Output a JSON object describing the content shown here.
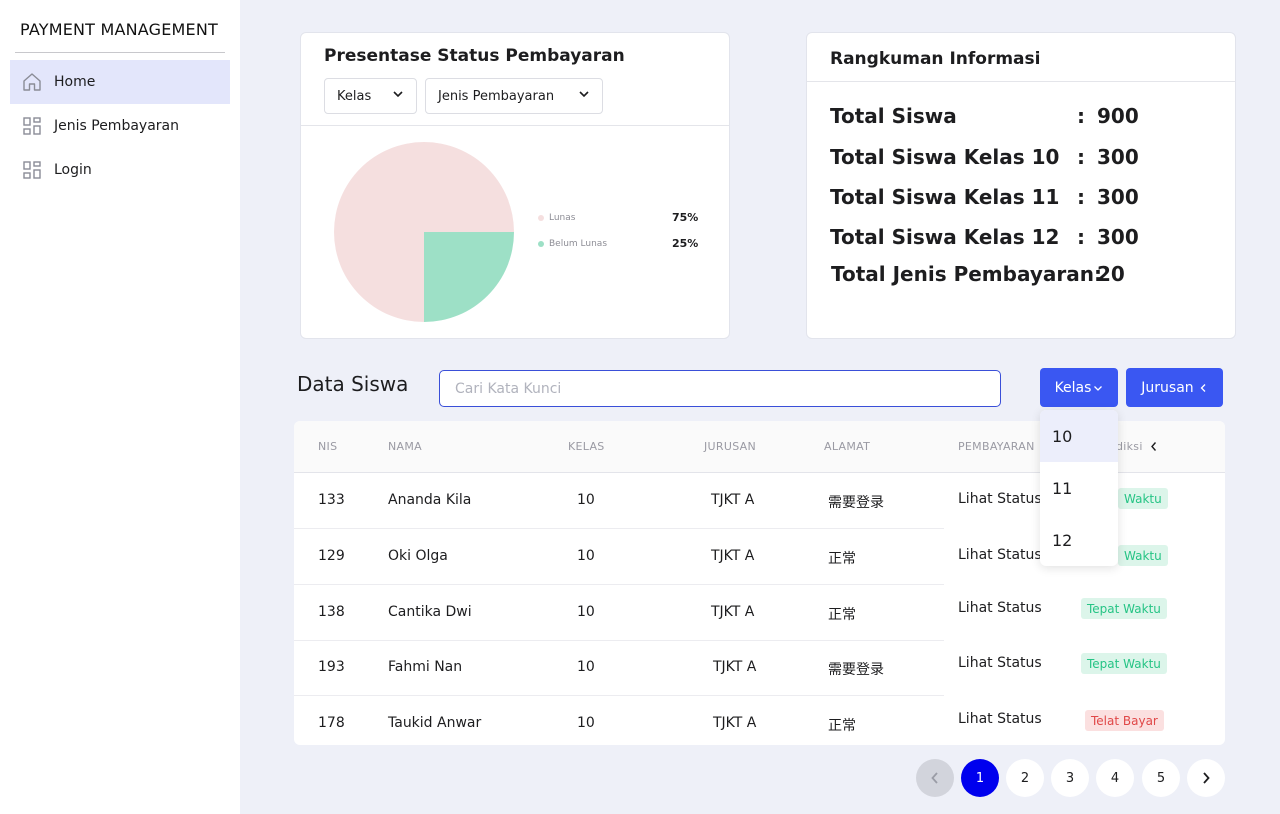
{
  "app": {
    "brand": "PAYMENT MANAGEMENT"
  },
  "sidebar": {
    "items": [
      {
        "label": "Home",
        "icon": "home-icon",
        "active": true
      },
      {
        "label": "Jenis Pembayaran",
        "icon": "grid-icon",
        "active": false
      },
      {
        "label": "Login",
        "icon": "grid-icon",
        "active": false
      }
    ]
  },
  "status_card": {
    "title": "Presentase Status Pembayaran",
    "filter_kelas": "Kelas",
    "filter_jenis": "Jenis Pembayaran",
    "legend": [
      {
        "label": "Lunas",
        "value": "75%",
        "color": "#f5dfdf"
      },
      {
        "label": "Belum Lunas",
        "value": "25%",
        "color": "#9de0c6"
      }
    ]
  },
  "chart_data": {
    "type": "pie",
    "categories": [
      "Lunas",
      "Belum Lunas"
    ],
    "values": [
      75,
      25
    ],
    "colors": [
      "#f5dfdf",
      "#9de0c6"
    ]
  },
  "summary_card": {
    "title": "Rangkuman Informasi",
    "rows": [
      {
        "label": "Total Siswa",
        "colon": ":",
        "value": "900"
      },
      {
        "label": "Total Siswa Kelas 10",
        "colon": ":",
        "value": "300"
      },
      {
        "label": "Total Siswa Kelas 11",
        "colon": ":",
        "value": "300"
      },
      {
        "label": "Total Siswa Kelas 12",
        "colon": ":",
        "value": "300"
      },
      {
        "label": "Total Jenis Pembayaran:",
        "colon": "",
        "value": "20"
      }
    ]
  },
  "data_siswa": {
    "title": "Data Siswa",
    "search_placeholder": "Cari Kata Kunci",
    "kelas_button": "Kelas",
    "jurusan_button": "Jurusan",
    "dropdown_options": [
      "10",
      "11",
      "12"
    ],
    "columns": [
      "NIS",
      "NAMA",
      "KELAS",
      "JURUSAN",
      "ALAMAT",
      "PEMBAYARAN",
      "diksi"
    ],
    "rows": [
      {
        "nis": "133",
        "nama": "Ananda Kila",
        "kelas": "10",
        "jurusan": "TJKT A",
        "alamat": "需要登录",
        "pembayaran": "Lihat Status",
        "status": "Waktu",
        "status_type": "ok"
      },
      {
        "nis": "129",
        "nama": "Oki Olga",
        "kelas": "10",
        "jurusan": "TJKT A",
        "alamat": "正常",
        "pembayaran": "Lihat Status",
        "status": "Waktu",
        "status_type": "ok"
      },
      {
        "nis": "138",
        "nama": "Cantika Dwi",
        "kelas": "10",
        "jurusan": "TJKT A",
        "alamat": "正常",
        "pembayaran": "Lihat Status",
        "status": "Tepat Waktu",
        "status_type": "ok"
      },
      {
        "nis": "193",
        "nama": "Fahmi Nan",
        "kelas": "10",
        "jurusan": "TJKT A",
        "alamat": "需要登录",
        "pembayaran": "Lihat Status",
        "status": "Tepat Waktu",
        "status_type": "ok"
      },
      {
        "nis": "178",
        "nama": "Taukid Anwar",
        "kelas": "10",
        "jurusan": "TJKT A",
        "alamat": "正常",
        "pembayaran": "Lihat Status",
        "status": "Telat Bayar",
        "status_type": "late"
      }
    ]
  },
  "pagination": {
    "pages": [
      "1",
      "2",
      "3",
      "4",
      "5"
    ],
    "current": "1"
  }
}
